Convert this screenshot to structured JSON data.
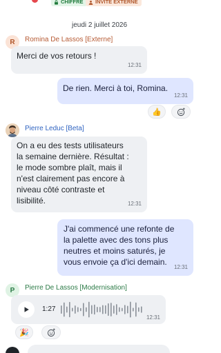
{
  "header": {
    "badges": [
      {
        "label": "CHIFFRÉ",
        "icon": "lock-icon"
      },
      {
        "label": "INVITÉ EXTERNE",
        "icon": "person-icon"
      }
    ]
  },
  "date_separator": "jeudi 2 juillet 2026",
  "messages": [
    {
      "sender": "Romina De Lassos [Externe]",
      "avatar_letter": "R",
      "text": "Merci de vos retours !",
      "time": "12:31"
    },
    {
      "text": "De rien. Merci à toi, Romina.",
      "time": "12:31",
      "reactions": [
        "👍",
        "smiley-add-icon"
      ]
    },
    {
      "sender": "Pierre Leduc [Beta]",
      "avatar": "user-photo",
      "text": "On a eu des tests utilisateurs\nla semaine dernière. Résultat :\nle mode sombre plaît, mais il\nn'est clairement pas encore à\nniveau côté contraste et\nlisibilité.",
      "time": "12:31"
    },
    {
      "text": "J'ai commencé une refonte de\nla palette avec des tons plus\nneutres et moins saturés, je\nvous envoie ça d'ici demain.",
      "time": "12:31"
    },
    {
      "sender": "Pierre De Lassos [Modernisation]",
      "avatar_letter": "P",
      "type": "voice",
      "duration": "1:27",
      "time": "12:31",
      "reactions": [
        "🎉",
        "smiley-add-icon"
      ]
    }
  ],
  "colors": {
    "incoming_bubble": "#eef0f3",
    "outgoing_bubble": "#dfe6ff",
    "romina_name": "#b65a33",
    "pierre_name": "#2f63c0",
    "pde_name": "#2b7a46"
  }
}
